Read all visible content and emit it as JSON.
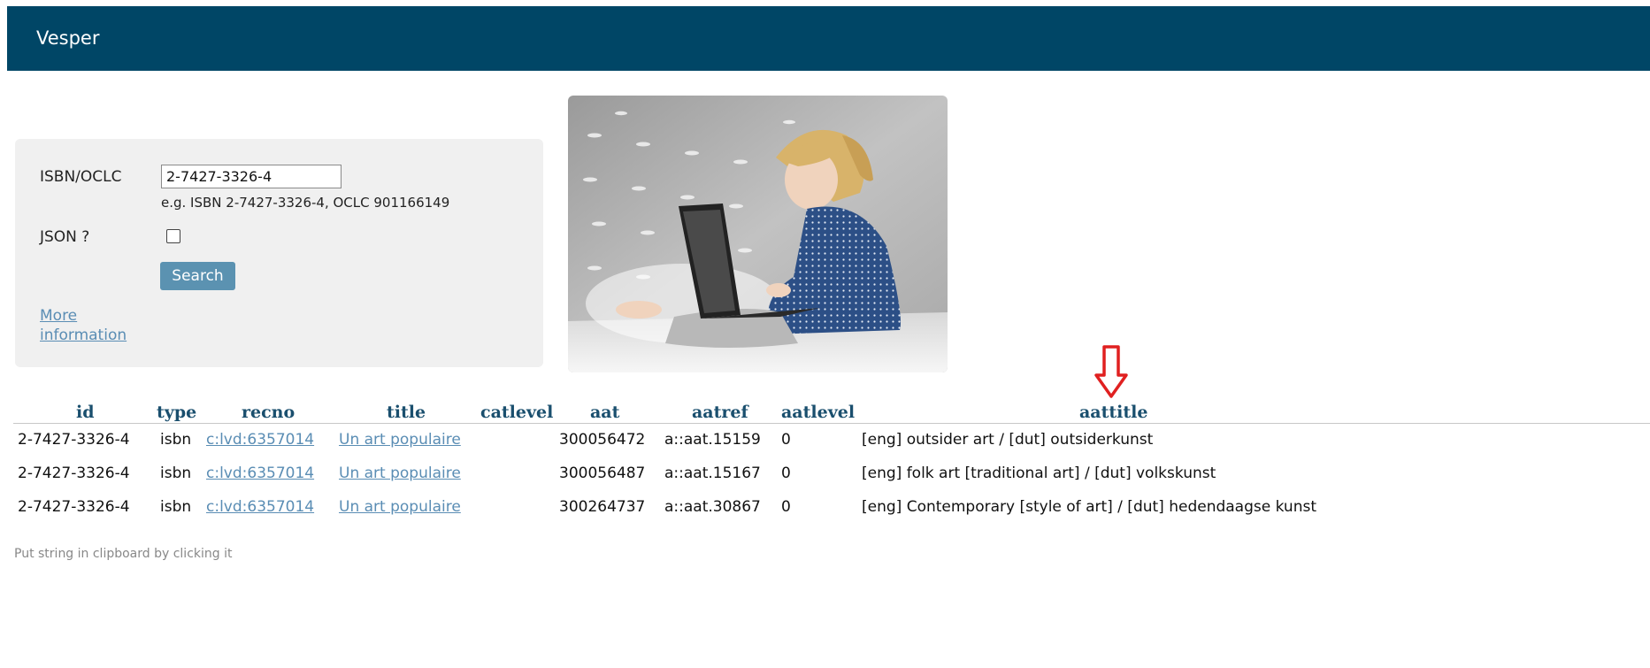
{
  "header": {
    "brand": "Vesper"
  },
  "form": {
    "isbn_label": "ISBN/OCLC",
    "isbn_value": "2-7427-3326-4",
    "hint": "e.g. ISBN 2-7427-3326-4, OCLC 901166149",
    "json_label": "JSON ?",
    "json_checked": false,
    "search_label": "Search",
    "more_line1": "More",
    "more_line2": "information"
  },
  "arrow_color": "#e02020",
  "accent_color": "#004666",
  "table": {
    "headers": {
      "id": "id",
      "type": "type",
      "recno": "recno",
      "title": "title",
      "catlevel": "catlevel",
      "aat": "aat",
      "aatref": "aatref",
      "aatlevel": "aatlevel",
      "aattitle": "aattitle"
    },
    "rows": [
      {
        "id": "2-7427-3326-4",
        "type": "isbn",
        "recno": "c:lvd:6357014",
        "title": "Un art populaire",
        "catlevel": "",
        "aat": "300056472",
        "aatref": "a::aat.15159",
        "aatlevel": "0",
        "aattitle": "[eng] outsider art / [dut] outsiderkunst"
      },
      {
        "id": "2-7427-3326-4",
        "type": "isbn",
        "recno": "c:lvd:6357014",
        "title": "Un art populaire",
        "catlevel": "",
        "aat": "300056487",
        "aatref": "a::aat.15167",
        "aatlevel": "0",
        "aattitle": "[eng] folk art [traditional art] / [dut] volkskunst"
      },
      {
        "id": "2-7427-3326-4",
        "type": "isbn",
        "recno": "c:lvd:6357014",
        "title": "Un art populaire",
        "catlevel": "",
        "aat": "300264737",
        "aatref": "a::aat.30867",
        "aatlevel": "0",
        "aattitle": "[eng] Contemporary [style of art] / [dut] hedendaagse kunst"
      }
    ]
  },
  "footer": {
    "note": "Put string in clipboard by clicking it"
  }
}
